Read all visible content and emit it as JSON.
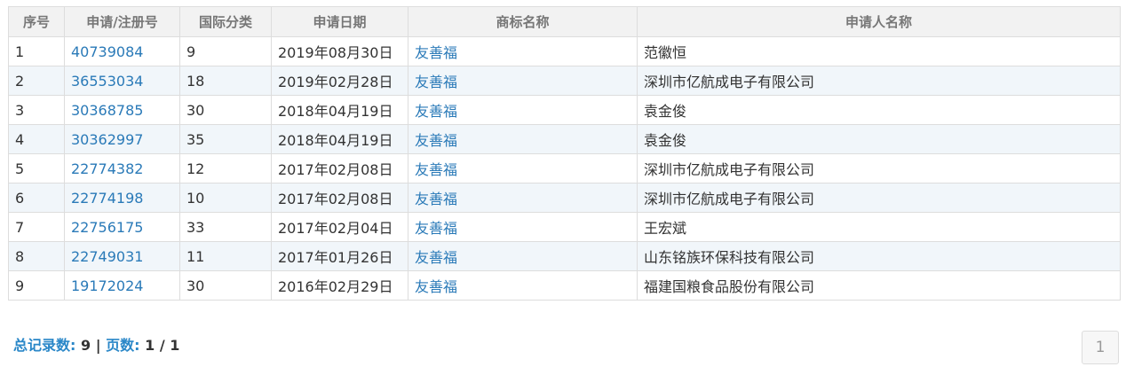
{
  "table": {
    "headers": [
      "序号",
      "申请/注册号",
      "国际分类",
      "申请日期",
      "商标名称",
      "申请人名称"
    ],
    "rows": [
      {
        "no": "1",
        "reg": "40739084",
        "cls": "9",
        "date": "2019年08月30日",
        "name": "友善福",
        "applicant": "范徽恒"
      },
      {
        "no": "2",
        "reg": "36553034",
        "cls": "18",
        "date": "2019年02月28日",
        "name": "友善福",
        "applicant": "深圳市亿航成电子有限公司"
      },
      {
        "no": "3",
        "reg": "30368785",
        "cls": "30",
        "date": "2018年04月19日",
        "name": "友善福",
        "applicant": "袁金俊"
      },
      {
        "no": "4",
        "reg": "30362997",
        "cls": "35",
        "date": "2018年04月19日",
        "name": "友善福",
        "applicant": "袁金俊"
      },
      {
        "no": "5",
        "reg": "22774382",
        "cls": "12",
        "date": "2017年02月08日",
        "name": "友善福",
        "applicant": "深圳市亿航成电子有限公司"
      },
      {
        "no": "6",
        "reg": "22774198",
        "cls": "10",
        "date": "2017年02月08日",
        "name": "友善福",
        "applicant": "深圳市亿航成电子有限公司"
      },
      {
        "no": "7",
        "reg": "22756175",
        "cls": "33",
        "date": "2017年02月04日",
        "name": "友善福",
        "applicant": "王宏斌"
      },
      {
        "no": "8",
        "reg": "22749031",
        "cls": "11",
        "date": "2017年01月26日",
        "name": "友善福",
        "applicant": "山东铭族环保科技有限公司"
      },
      {
        "no": "9",
        "reg": "19172024",
        "cls": "30",
        "date": "2016年02月29日",
        "name": "友善福",
        "applicant": "福建国粮食品股份有限公司"
      }
    ]
  },
  "footer": {
    "total_label": "总记录数:",
    "total_value": "9",
    "separator": "|",
    "pages_label": "页数:",
    "pages_value": "1 / 1"
  },
  "pager": {
    "current": "1"
  }
}
